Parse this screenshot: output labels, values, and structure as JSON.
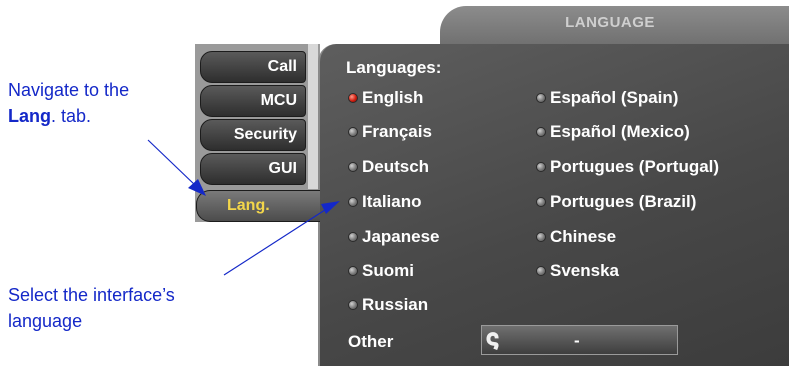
{
  "annotations": {
    "navigate_prefix": "Navigate to the",
    "navigate_bold": "Lang",
    "navigate_suffix": ". tab.",
    "select_line1": "Select the interface’s",
    "select_line2": "language"
  },
  "header": {
    "title": "LANGUAGE"
  },
  "tabs": [
    {
      "label": "Call",
      "active": false
    },
    {
      "label": "MCU",
      "active": false
    },
    {
      "label": "Security",
      "active": false
    },
    {
      "label": "GUI",
      "active": false
    },
    {
      "label": "Lang.",
      "active": true
    }
  ],
  "languages": {
    "heading": "Languages:",
    "left_column": [
      "English",
      "Français",
      "Deutsch",
      "Italiano",
      "Japanese",
      "Suomi",
      "Russian"
    ],
    "right_column": [
      "Español (Spain)",
      "Español (Mexico)",
      "Portugues (Portugal)",
      "Portugues (Brazil)",
      "Chinese",
      "Svenska"
    ],
    "selected": "English"
  },
  "other": {
    "label": "Other",
    "value": "-",
    "icon": "swirl-icon"
  },
  "colors": {
    "annotation": "#1428c8",
    "active_tab_text": "#f3d64a",
    "selected_radio": "#d01e10",
    "panel": "#4a4a4a"
  }
}
